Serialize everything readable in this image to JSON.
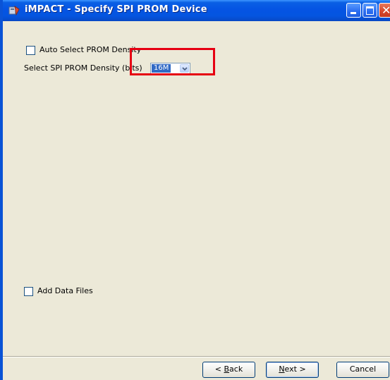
{
  "window": {
    "title": "iMPACT - Specify SPI PROM Device",
    "icon": "impact-app-icon",
    "controls": {
      "minimize": "minimize-icon",
      "maximize": "maximize-icon",
      "close": "close-icon"
    }
  },
  "options": {
    "auto_select_label": "Auto Select PROM Density",
    "auto_select_checked": false,
    "density_label": "Select SPI PROM Density (bits)",
    "density_value": "16M",
    "add_data_files_label": "Add Data Files",
    "add_data_files_checked": false
  },
  "buttons": {
    "back_prefix": "< ",
    "back_mnemonic": "B",
    "back_rest": "ack",
    "next_mnemonic": "N",
    "next_rest": "ext >",
    "cancel": "Cancel"
  },
  "colors": {
    "titlebar": "#0554e3",
    "dialog_bg": "#ece9d8",
    "selection": "#316ac5",
    "highlight": "#e60012"
  }
}
